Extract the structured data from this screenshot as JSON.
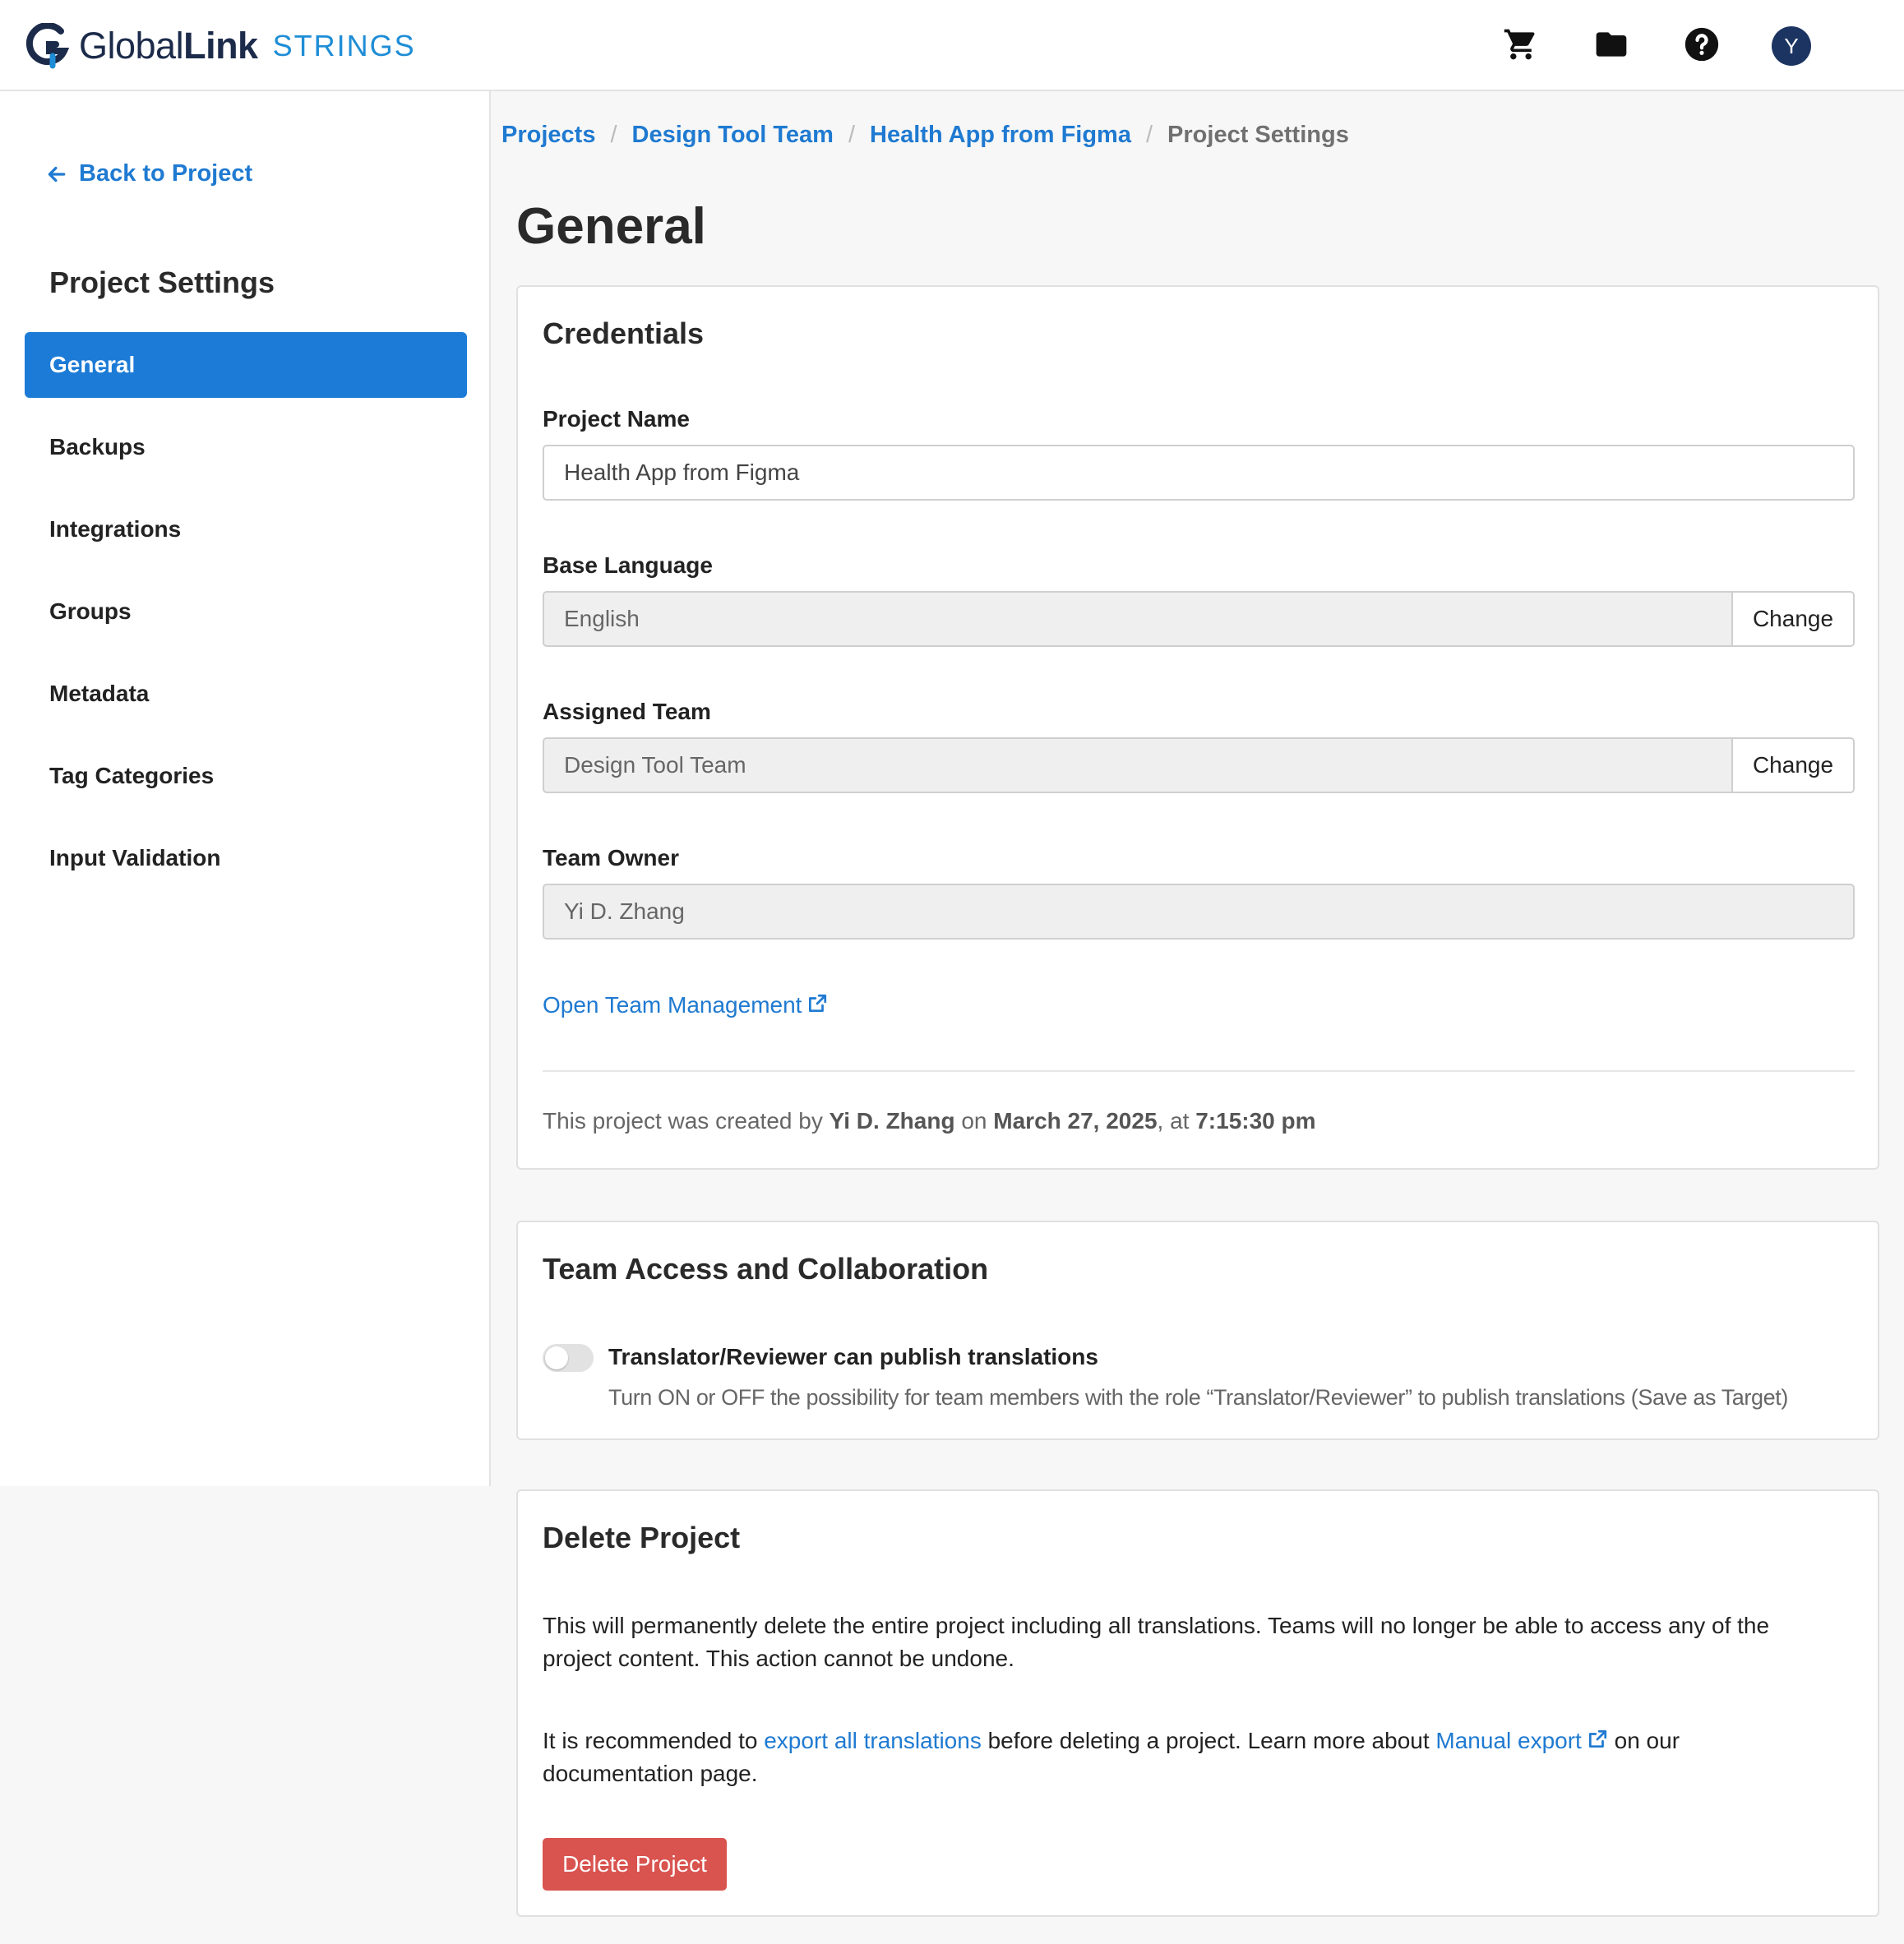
{
  "header": {
    "brand_regular": "Global",
    "brand_bold": "Link",
    "product": "STRINGS",
    "icons": [
      "cart-icon",
      "folder-icon",
      "help-icon"
    ],
    "avatar_initial": "Y"
  },
  "sidebar": {
    "back_label": "Back to Project",
    "title": "Project Settings",
    "items": [
      {
        "label": "General",
        "active": true
      },
      {
        "label": "Backups"
      },
      {
        "label": "Integrations"
      },
      {
        "label": "Groups"
      },
      {
        "label": "Metadata"
      },
      {
        "label": "Tag Categories"
      },
      {
        "label": "Input Validation"
      }
    ]
  },
  "breadcrumb": {
    "items": [
      "Projects",
      "Design Tool Team",
      "Health App from Figma"
    ],
    "current": "Project Settings"
  },
  "page": {
    "title": "General"
  },
  "credentials": {
    "title": "Credentials",
    "project_name_label": "Project Name",
    "project_name_value": "Health App from Figma",
    "base_language_label": "Base Language",
    "base_language_value": "English",
    "assigned_team_label": "Assigned Team",
    "assigned_team_value": "Design Tool Team",
    "team_owner_label": "Team Owner",
    "team_owner_value": "Yi D. Zhang",
    "change_label": "Change",
    "team_management_link": "Open Team Management",
    "created_prefix": "This project was created by",
    "created_by": "Yi D. Zhang",
    "created_on_word": "on",
    "created_date": "March 27, 2025",
    "created_at_word": ", at",
    "created_time": "7:15:30 pm"
  },
  "team_access": {
    "title": "Team Access and Collaboration",
    "toggle_label": "Translator/Reviewer can publish translations",
    "toggle_on": false,
    "toggle_description": "Turn ON or OFF the possibility for team members with the role “Translator/Reviewer” to publish translations (Save as Target)"
  },
  "delete_project": {
    "title": "Delete Project",
    "warning": "This will permanently delete the entire project including all translations. Teams will no longer be able to access any of the project content. This action cannot be undone.",
    "rec_prefix": "It is recommended to",
    "export_link": "export all translations",
    "rec_middle": "before deleting a project. Learn more about",
    "manual_export_link": "Manual export",
    "rec_suffix": "on our documentation page.",
    "button_label": "Delete Project"
  },
  "colors": {
    "accent": "#1c7bd6",
    "link": "#1f7ad1",
    "danger": "#d9534f",
    "avatar": "#1c3461"
  }
}
